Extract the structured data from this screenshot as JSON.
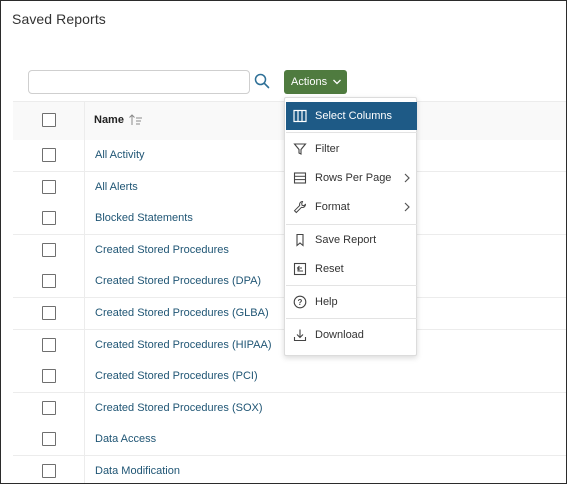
{
  "page": {
    "title": "Saved Reports"
  },
  "search": {
    "value": "",
    "placeholder": "",
    "icon": "search-icon"
  },
  "actions": {
    "label": "Actions"
  },
  "table": {
    "columns": {
      "name": "Name"
    },
    "rows": [
      "All Activity",
      "All Alerts",
      "Blocked Statements",
      "Created Stored Procedures",
      "Created Stored Procedures (DPA)",
      "Created Stored Procedures (GLBA)",
      "Created Stored Procedures (HIPAA)",
      "Created Stored Procedures (PCI)",
      "Created Stored Procedures (SOX)",
      "Data Access",
      "Data Modification"
    ]
  },
  "menu": {
    "items": [
      {
        "label": "Select Columns",
        "icon": "columns-icon",
        "active": true,
        "submenu": false
      },
      {
        "label": "Filter",
        "icon": "filter-icon",
        "active": false,
        "submenu": false
      },
      {
        "label": "Rows Per Page",
        "icon": "rows-icon",
        "active": false,
        "submenu": true
      },
      {
        "label": "Format",
        "icon": "wrench-icon",
        "active": false,
        "submenu": true
      },
      {
        "label": "Save Report",
        "icon": "bookmark-icon",
        "active": false,
        "submenu": false
      },
      {
        "label": "Reset",
        "icon": "reset-icon",
        "active": false,
        "submenu": false
      },
      {
        "label": "Help",
        "icon": "help-icon",
        "active": false,
        "submenu": false
      },
      {
        "label": "Download",
        "icon": "download-icon",
        "active": false,
        "submenu": false
      }
    ]
  },
  "colors": {
    "accent": "#1e5a86",
    "actions_button": "#4f7b3f",
    "link": "#1f5574"
  }
}
